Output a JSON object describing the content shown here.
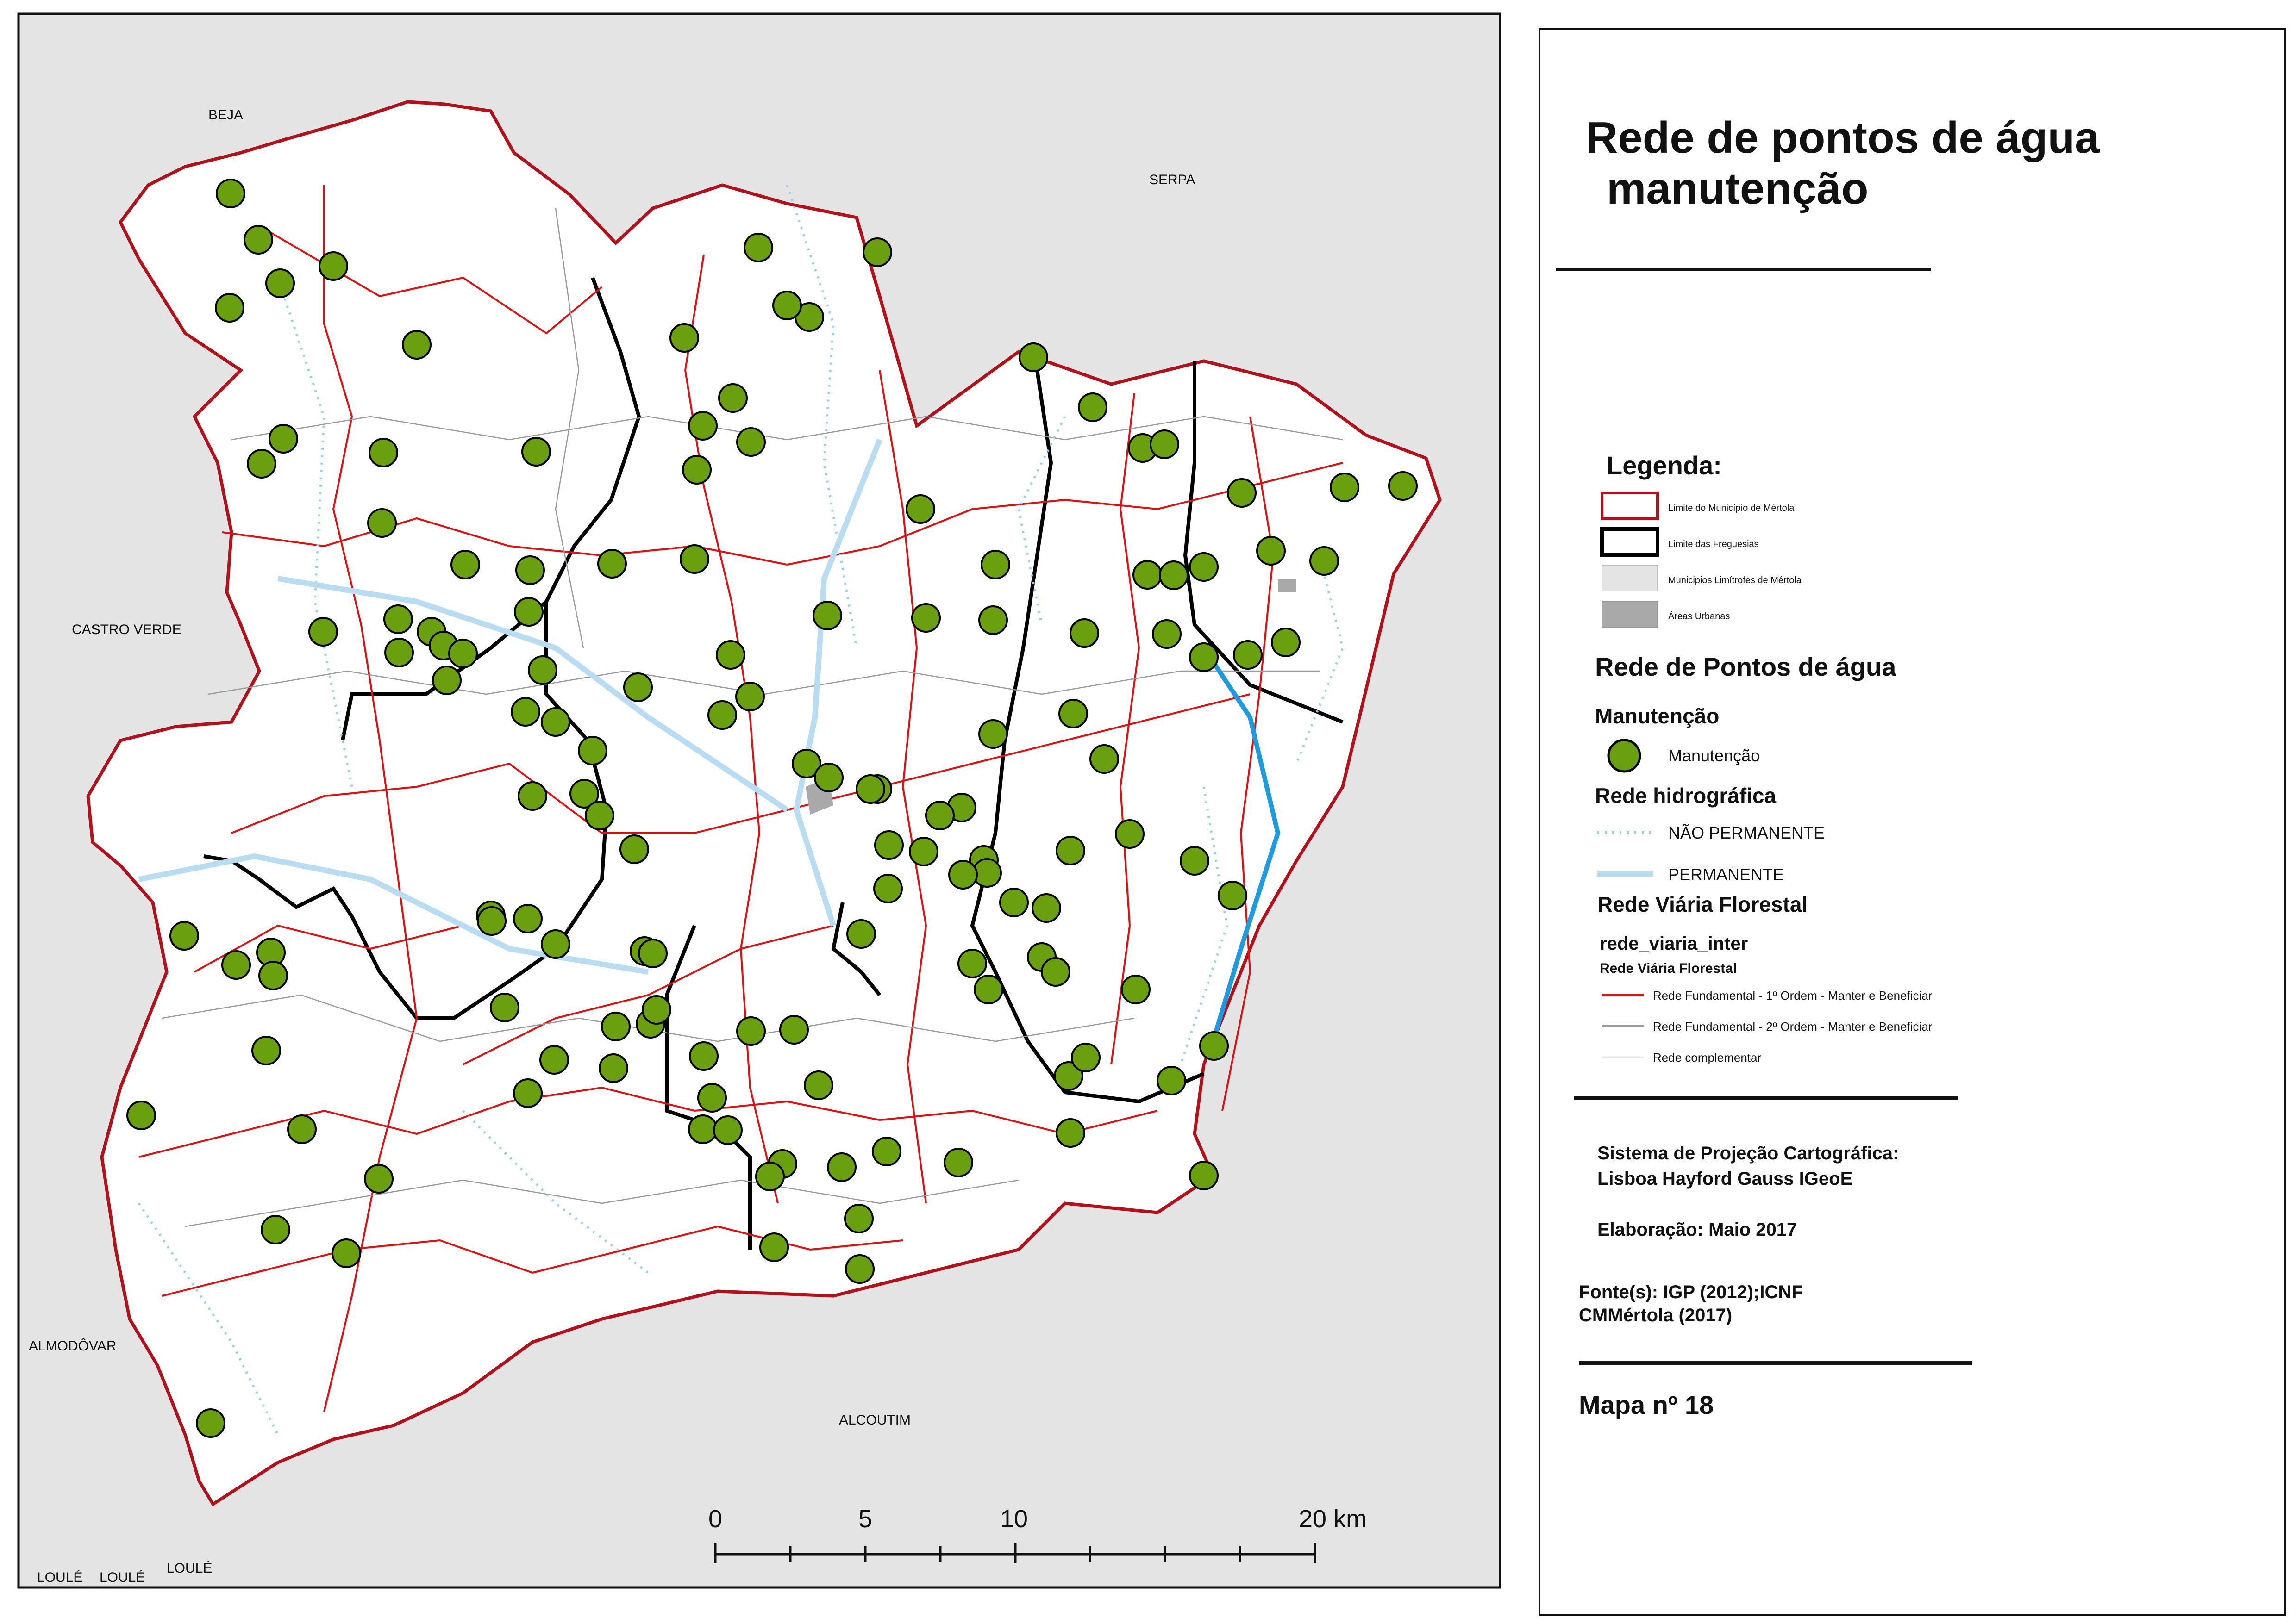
{
  "title_line1": "Rede de pontos de água",
  "title_line2": "manutenção",
  "legend": {
    "heading": "Legenda:",
    "items": [
      {
        "label": "Limite do Município de Mértola"
      },
      {
        "label": "Limite das Freguesias"
      },
      {
        "label": "Municipios Limítrofes de Mértola"
      },
      {
        "label": "Áreas Urbanas"
      }
    ],
    "points_heading": "Rede de Pontos de água",
    "maintenance_heading": "Manutenção",
    "maintenance_label": "Manutenção",
    "hydro_heading": "Rede hidrográfica",
    "hydro_items": [
      {
        "label": "NÃO PERMANENTE"
      },
      {
        "label": "PERMANENTE"
      }
    ],
    "roads_heading": "Rede Viária Florestal",
    "roads_layer": "rede_viaria_inter",
    "roads_sublayer": "Rede Viária Florestal",
    "roads_items": [
      {
        "label": "Rede Fundamental - 1º Ordem  - Manter e Beneficiar"
      },
      {
        "label": "Rede Fundamental - 2º Ordem  - Manter e Beneficiar"
      },
      {
        "label": "Rede complementar"
      }
    ]
  },
  "projection_line1": "Sistema de Projeção Cartográfica:",
  "projection_line2": "Lisboa Hayford Gauss IGeoE",
  "elaboration": "Elaboração: Maio 2017",
  "source_line1": "Fonte(s): IGP (2012);ICNF",
  "source_line2": "CMMértola (2017)",
  "map_number": "Mapa nº 18",
  "places": {
    "beja": "BEJA",
    "serpa": "SERPA",
    "castro_verde": "CASTRO VERDE",
    "almodovar": "ALMODÔVAR",
    "alcoutim": "ALCOUTIM",
    "loule_1": "LOULÉ",
    "loule_2": "LOULÉ",
    "loule_3": "LOULÉ"
  },
  "scale": {
    "ticks": [
      "0",
      "5",
      "10",
      "20 km"
    ]
  },
  "colors": {
    "outside": "#e4e4e4",
    "municipality_limit": "#b3101a",
    "parish_limit": "#000000",
    "point_fill": "#6aa00f",
    "road_primary": "#e01010",
    "road_secondary": "#9a9a9a",
    "water": "#1e9be0",
    "stream": "#8fd0f0"
  }
}
